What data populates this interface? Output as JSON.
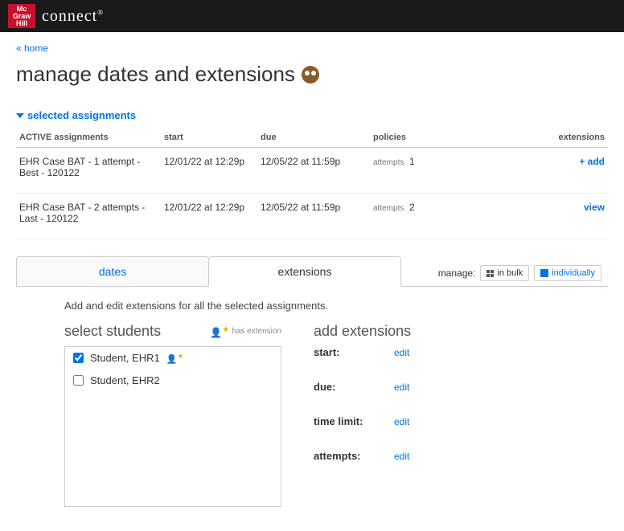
{
  "brand": {
    "logo_line1": "Mc",
    "logo_line2": "Graw",
    "logo_line3": "Hill",
    "product": "connect",
    "reg": "®"
  },
  "nav": {
    "home": "« home"
  },
  "page_title": "manage dates and extensions",
  "section_toggle": "selected assignments",
  "columns": {
    "active": "ACTIVE assignments",
    "start": "start",
    "due": "due",
    "policies": "policies",
    "extensions": "extensions"
  },
  "attempts_word": "attempts",
  "assignments": [
    {
      "name": "EHR Case BAT - 1 attempt - Best - 120122",
      "start": "12/01/22 at 12:29p",
      "due": "12/05/22 at 11:59p",
      "attempts": "1",
      "action": "+ add"
    },
    {
      "name": "EHR Case BAT - 2 attempts - Last - 120122",
      "start": "12/01/22 at 12:29p",
      "due": "12/05/22 at 11:59p",
      "attempts": "2",
      "action": "view"
    }
  ],
  "tabs": {
    "dates": "dates",
    "extensions": "extensions"
  },
  "manage": {
    "label": "manage:",
    "bulk": "in bulk",
    "individually": "individually"
  },
  "intro": "Add and edit extensions for all the selected assignments.",
  "select_students": {
    "title": "select students",
    "has_extension": "has extension",
    "students": [
      {
        "name": "Student, EHR1",
        "checked": true,
        "has_ext": true
      },
      {
        "name": "Student, EHR2",
        "checked": false,
        "has_ext": false
      }
    ]
  },
  "add_extensions": {
    "title": "add extensions",
    "rows": [
      {
        "label": "start:",
        "action": "edit"
      },
      {
        "label": "due:",
        "action": "edit"
      },
      {
        "label": "time limit:",
        "action": "edit"
      },
      {
        "label": "attempts:",
        "action": "edit"
      }
    ]
  }
}
